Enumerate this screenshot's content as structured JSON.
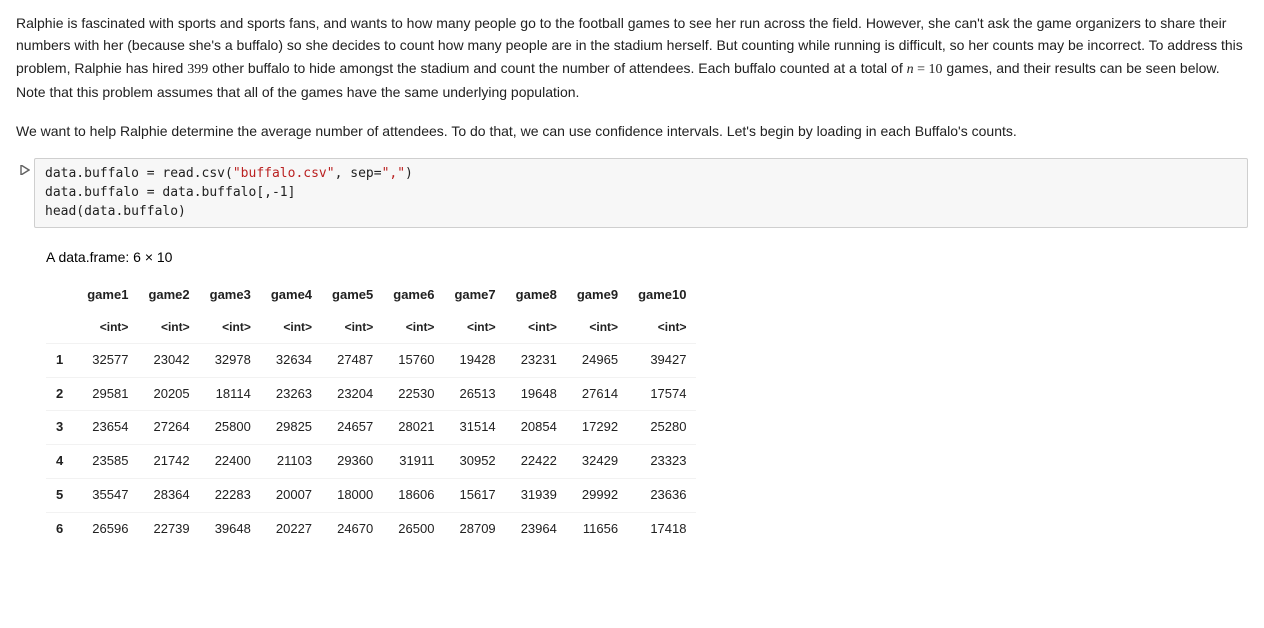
{
  "paragraphs": {
    "p1_a": "Ralphie is fascinated with sports and sports fans, and wants to how many people go to the football games to see her run across the field. However, she can't ask the game organizers to share their numbers with her (because she's a buffalo) so she decides to count how many people are in the stadium herself. But counting while running is difficult, so her counts may be incorrect. To address this problem, Ralphie has hired ",
    "p1_count": "399",
    "p1_b": " other buffalo to hide amongst the stadium and count the number of attendees. Each buffalo counted at a total of ",
    "p1_nvar": "n",
    "p1_eq": " = ",
    "p1_nval": "10",
    "p1_c": " games, and their results can be seen below. Note that this problem assumes that all of the games have the same underlying population.",
    "p2": "We want to help Ralphie determine the average number of attendees. To do that, we can use confidence intervals. Let's begin by loading in each Buffalo's counts."
  },
  "code": {
    "line1_a": "data.buffalo = read.csv(",
    "line1_str": "\"buffalo.csv\"",
    "line1_b": ", sep=",
    "line1_str2": "\",\"",
    "line1_c": ")",
    "line2": "data.buffalo = data.buffalo[,-1]",
    "line3": "head(data.buffalo)"
  },
  "output": {
    "caption": "A data.frame: 6 × 10",
    "headers": [
      "game1",
      "game2",
      "game3",
      "game4",
      "game5",
      "game6",
      "game7",
      "game8",
      "game9",
      "game10"
    ],
    "type_label": "<int>",
    "row_indices": [
      "1",
      "2",
      "3",
      "4",
      "5",
      "6"
    ],
    "rows": [
      [
        32577,
        23042,
        32978,
        32634,
        27487,
        15760,
        19428,
        23231,
        24965,
        39427
      ],
      [
        29581,
        20205,
        18114,
        23263,
        23204,
        22530,
        26513,
        19648,
        27614,
        17574
      ],
      [
        23654,
        27264,
        25800,
        29825,
        24657,
        28021,
        31514,
        20854,
        17292,
        25280
      ],
      [
        23585,
        21742,
        22400,
        21103,
        29360,
        31911,
        30952,
        22422,
        32429,
        23323
      ],
      [
        35547,
        28364,
        22283,
        20007,
        18000,
        18606,
        15617,
        31939,
        29992,
        23636
      ],
      [
        26596,
        22739,
        39648,
        20227,
        24670,
        26500,
        28709,
        23964,
        11656,
        17418
      ]
    ]
  },
  "chart_data": {
    "type": "table",
    "title": "A data.frame: 6 × 10",
    "columns": [
      "game1",
      "game2",
      "game3",
      "game4",
      "game5",
      "game6",
      "game7",
      "game8",
      "game9",
      "game10"
    ],
    "row_index": [
      1,
      2,
      3,
      4,
      5,
      6
    ],
    "values": [
      [
        32577,
        23042,
        32978,
        32634,
        27487,
        15760,
        19428,
        23231,
        24965,
        39427
      ],
      [
        29581,
        20205,
        18114,
        23263,
        23204,
        22530,
        26513,
        19648,
        27614,
        17574
      ],
      [
        23654,
        27264,
        25800,
        29825,
        24657,
        28021,
        31514,
        20854,
        17292,
        25280
      ],
      [
        23585,
        21742,
        22400,
        21103,
        29360,
        31911,
        30952,
        22422,
        32429,
        23323
      ],
      [
        35547,
        28364,
        22283,
        20007,
        18000,
        18606,
        15617,
        31939,
        29992,
        23636
      ],
      [
        26596,
        22739,
        39648,
        20227,
        24670,
        26500,
        28709,
        23964,
        11656,
        17418
      ]
    ]
  }
}
